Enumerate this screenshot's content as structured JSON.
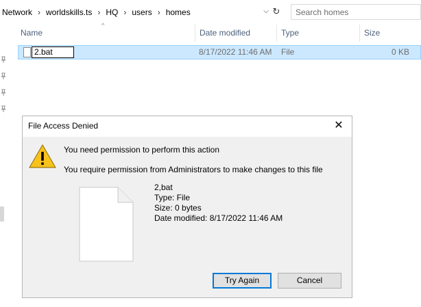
{
  "address_bar": {
    "breadcrumbs": [
      "Network",
      "worldskills.ts",
      "HQ",
      "users",
      "homes"
    ],
    "separator": "›",
    "dropdown_glyph": "⌵",
    "refresh_glyph": "↻",
    "search_placeholder": "Search homes"
  },
  "columns": {
    "name": "Name",
    "date_modified": "Date modified",
    "type": "Type",
    "size": "Size",
    "sort_glyph": "^"
  },
  "file": {
    "name": "2.bat",
    "date_modified": "8/17/2022 11:46 AM",
    "type": "File",
    "size": "0 KB"
  },
  "dialog": {
    "title": "File Access Denied",
    "close_glyph": "✕",
    "message_main": "You need permission to perform this action",
    "message_detail": "You require permission from Administrators to make changes to this file",
    "file_name": "2,bat",
    "file_type": "Type: File",
    "file_size": "Size: 0 bytes",
    "file_date": "Date modified: 8/17/2022 11:46 AM",
    "try_again_label": "Try Again",
    "cancel_label": "Cancel"
  },
  "colors": {
    "selection": "#cce8ff",
    "selection_border": "#99d1ff",
    "header_text": "#4c607a",
    "dialog_bg": "#f0f0f0",
    "default_button_border": "#0078d7",
    "warning_yellow": "#f7c21c"
  },
  "icons": [
    "pin-icon",
    "file-icon",
    "warning-icon",
    "close-icon",
    "refresh-icon",
    "chevron-down-icon"
  ]
}
